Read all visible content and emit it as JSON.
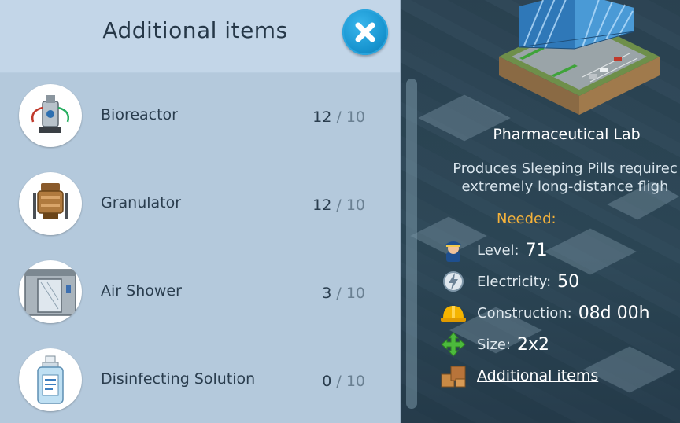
{
  "panel": {
    "title": "Additional items",
    "items": [
      {
        "name": "Bioreactor",
        "have": "12",
        "sep": "/",
        "need": "10",
        "icon": "bioreactor-icon"
      },
      {
        "name": "Granulator",
        "have": "12",
        "sep": "/",
        "need": "10",
        "icon": "granulator-icon"
      },
      {
        "name": "Air Shower",
        "have": "3",
        "sep": "/",
        "need": "10",
        "icon": "air-shower-icon"
      },
      {
        "name": "Disinfecting Solution",
        "have": "0",
        "sep": "/",
        "need": "10",
        "icon": "disinfectant-bottle-icon"
      }
    ]
  },
  "building": {
    "title": "Pharmaceutical Lab",
    "description_line1": "Produces Sleeping Pills requirec",
    "description_line2": "extremely long-distance fligh",
    "needed_label": "Needed:",
    "requirements": {
      "level_label": "Level:",
      "level_value": "71",
      "electricity_label": "Electricity:",
      "electricity_value": "50",
      "construction_label": "Construction:",
      "construction_value": "08d 00h",
      "size_label": "Size:",
      "size_value": "2x2",
      "additional_link": "Additional items"
    }
  },
  "colors": {
    "panel_bg": "#b4c9dc",
    "header_bg": "#c3d6e8",
    "close_button": "#1895d0",
    "needed_accent": "#f5b23a",
    "text_dark": "#2a3d4e"
  }
}
